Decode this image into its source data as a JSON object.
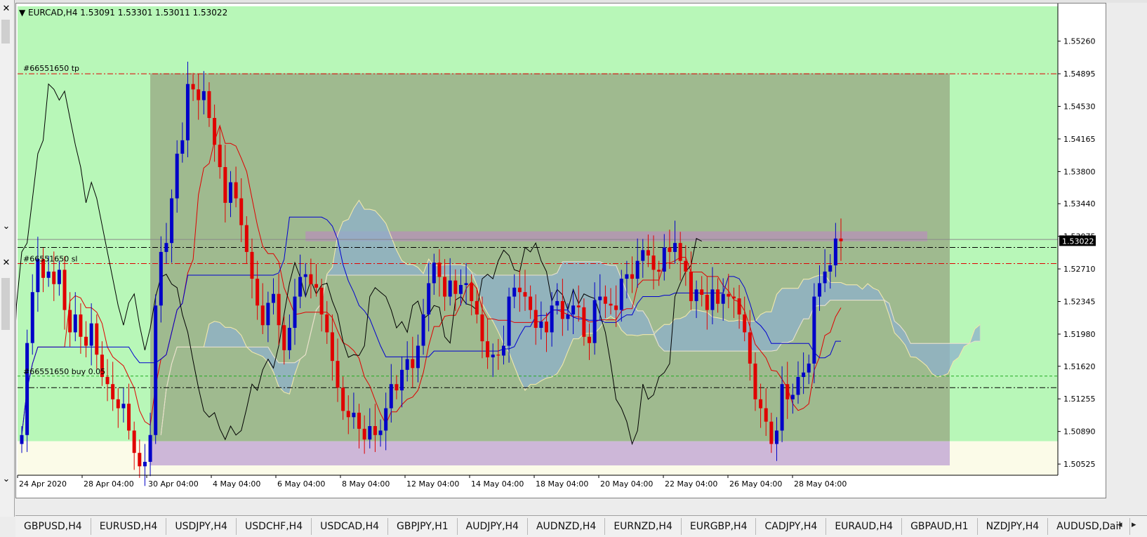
{
  "window": {
    "symbol_header": "EURCAD,H4  1.53091 1.53301 1.53011 1.53022",
    "header_arrow": "▼"
  },
  "colors": {
    "background": "#b8f7b8",
    "background_lower": "#fbfbe8",
    "rect_zone": "#9fba8f",
    "purple_zone": "#cdb7d8",
    "bull": "#0000c8",
    "bear": "#e00000",
    "cloud": "#8eb1cc",
    "tenkan": "#e00000",
    "kijun": "#0000d0",
    "chikou": "#000000"
  },
  "order_labels": {
    "tp": "#66551650 tp",
    "sl": "#66551650 sl",
    "buy": "#66551650 buy 0.05"
  },
  "chart_data": {
    "type": "candlestick",
    "symbol": "EURCAD",
    "timeframe": "H4",
    "ohlc_header": {
      "open": 1.53091,
      "high": 1.53301,
      "low": 1.53011,
      "close": 1.53022
    },
    "current_price": "1.53022",
    "ylim": [
      1.504,
      1.5565
    ],
    "price_ticks": [
      "1.55260",
      "1.54895",
      "1.54530",
      "1.54165",
      "1.53800",
      "1.53440",
      "1.53075",
      "1.52710",
      "1.52345",
      "1.51980",
      "1.51620",
      "1.51255",
      "1.50890",
      "1.50525"
    ],
    "time_labels": [
      "24 Apr 2020",
      "28 Apr 04:00",
      "30 Apr 04:00",
      "4 May 04:00",
      "6 May 04:00",
      "8 May 04:00",
      "12 May 04:00",
      "14 May 04:00",
      "18 May 04:00",
      "20 May 04:00",
      "22 May 04:00",
      "26 May 04:00",
      "28 May 04:00"
    ],
    "levels": {
      "tp": 1.54895,
      "sl": 1.5277,
      "buy": 1.5138,
      "green_dashed": 1.5151,
      "black_dashdot_upper": 1.5295,
      "grey_line": 1.5304
    },
    "close_series": [
      1.5085,
      1.5188,
      1.5245,
      1.5282,
      1.5261,
      1.5268,
      1.5254,
      1.527,
      1.5225,
      1.52,
      1.522,
      1.5195,
      1.5185,
      1.521,
      1.5175,
      1.515,
      1.5142,
      1.5125,
      1.5115,
      1.512,
      1.509,
      1.5065,
      1.505,
      1.5055,
      1.5085,
      1.523,
      1.529,
      1.53,
      1.535,
      1.54,
      1.5415,
      1.5478,
      1.5472,
      1.546,
      1.547,
      1.544,
      1.541,
      1.5385,
      1.5345,
      1.5368,
      1.535,
      1.532,
      1.529,
      1.526,
      1.523,
      1.5208,
      1.5233,
      1.5243,
      1.5208,
      1.518,
      1.5205,
      1.524,
      1.5262,
      1.5265,
      1.5254,
      1.525,
      1.522,
      1.52,
      1.5168,
      1.5138,
      1.5112,
      1.5105,
      1.511,
      1.5092,
      1.508,
      1.5095,
      1.5085,
      1.509,
      1.5115,
      1.5142,
      1.5135,
      1.5158,
      1.517,
      1.516,
      1.5185,
      1.522,
      1.5255,
      1.5278,
      1.5262,
      1.524,
      1.5258,
      1.5243,
      1.5253,
      1.5255,
      1.5235,
      1.522,
      1.519,
      1.5172,
      1.5175,
      1.5174,
      1.5185,
      1.524,
      1.525,
      1.5245,
      1.524,
      1.5225,
      1.5205,
      1.5212,
      1.52,
      1.523,
      1.5235,
      1.5215,
      1.522,
      1.523,
      1.5228,
      1.5195,
      1.5188,
      1.5236,
      1.524,
      1.5232,
      1.523,
      1.5225,
      1.526,
      1.5265,
      1.526,
      1.528,
      1.5292,
      1.5286,
      1.527,
      1.5268,
      1.5295,
      1.529,
      1.53,
      1.528,
      1.5268,
      1.5235,
      1.5248,
      1.5242,
      1.5225,
      1.5248,
      1.5232,
      1.5243,
      1.524,
      1.5238,
      1.522,
      1.52,
      1.5165,
      1.5125,
      1.5115,
      1.51,
      1.5075,
      1.509,
      1.5142,
      1.5125,
      1.513,
      1.515,
      1.5155,
      1.5165,
      1.524,
      1.5255,
      1.5268,
      1.5275,
      1.5305,
      1.5302
    ]
  },
  "tabs": [
    "GBPUSD,H4",
    "EURUSD,H4",
    "USDJPY,H4",
    "USDCHF,H4",
    "USDCAD,H4",
    "GBPJPY,H1",
    "AUDJPY,H4",
    "AUDNZD,H4",
    "EURNZD,H4",
    "EURGBP,H4",
    "CADJPY,H4",
    "EURAUD,H4",
    "GBPAUD,H1",
    "NZDJPY,H4",
    "AUDUSD,Dail"
  ],
  "gutter": {
    "close": "✕",
    "collapse": "⌄"
  },
  "tab_arrows": {
    "left": "◂",
    "right": "▸"
  }
}
